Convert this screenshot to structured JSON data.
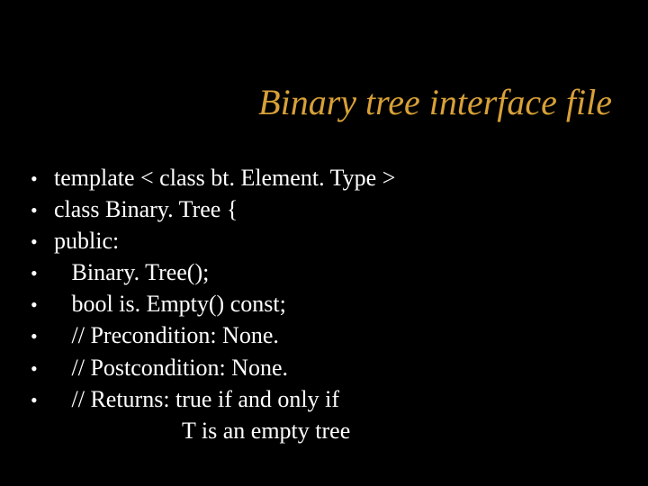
{
  "title": "Binary tree interface file",
  "lines": [
    "template < class bt. Element. Type >",
    "class Binary. Tree {",
    "public:",
    "   Binary. Tree();",
    "   bool is. Empty() const;",
    "   // Precondition: None.",
    "   // Postcondition: None.",
    "   // Returns: true if and only if"
  ],
  "continuation": "T is an empty tree"
}
